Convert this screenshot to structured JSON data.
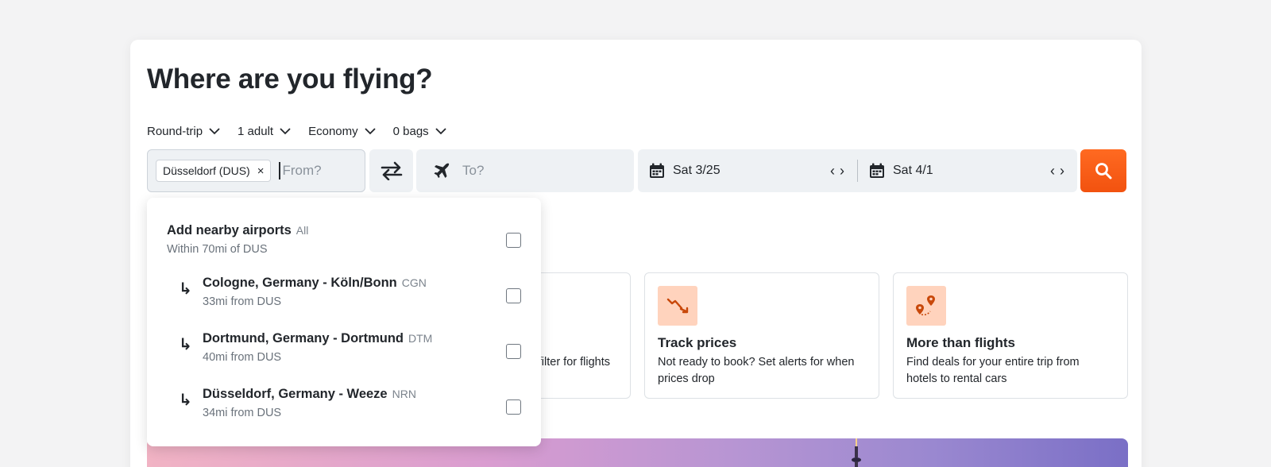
{
  "title": "Where are you flying?",
  "options": [
    {
      "label": "Round-trip"
    },
    {
      "label": "1 adult"
    },
    {
      "label": "Economy"
    },
    {
      "label": "0 bags"
    }
  ],
  "from": {
    "chip": "Düsseldorf (DUS)",
    "chip_remove": "×",
    "placeholder": "From?"
  },
  "to": {
    "placeholder": "To?"
  },
  "dates": {
    "depart": "Sat 3/25",
    "return": "Sat 4/1",
    "prev": "‹",
    "next": "›"
  },
  "features": [
    {
      "title": "",
      "description": "filter for flights"
    },
    {
      "title": "Track prices",
      "description": "Not ready to book? Set alerts for when prices drop"
    },
    {
      "title": "More than flights",
      "description": "Find deals for your entire trip from hotels to rental cars"
    }
  ],
  "nearby": {
    "title": "Add nearby airports",
    "all_label": "All",
    "subtitle": "Within 70mi of DUS",
    "airports": [
      {
        "name": "Cologne, Germany - Köln/Bonn",
        "code": "CGN",
        "distance": "33mi from DUS"
      },
      {
        "name": "Dortmund, Germany - Dortmund",
        "code": "DTM",
        "distance": "40mi from DUS"
      },
      {
        "name": "Düsseldorf, Germany - Weeze",
        "code": "NRN",
        "distance": "34mi from DUS"
      }
    ]
  },
  "colors": {
    "accent": "#ff5b1a",
    "feature_icon_bg": "#ffd3bd",
    "field_bg": "#eef1f4"
  }
}
